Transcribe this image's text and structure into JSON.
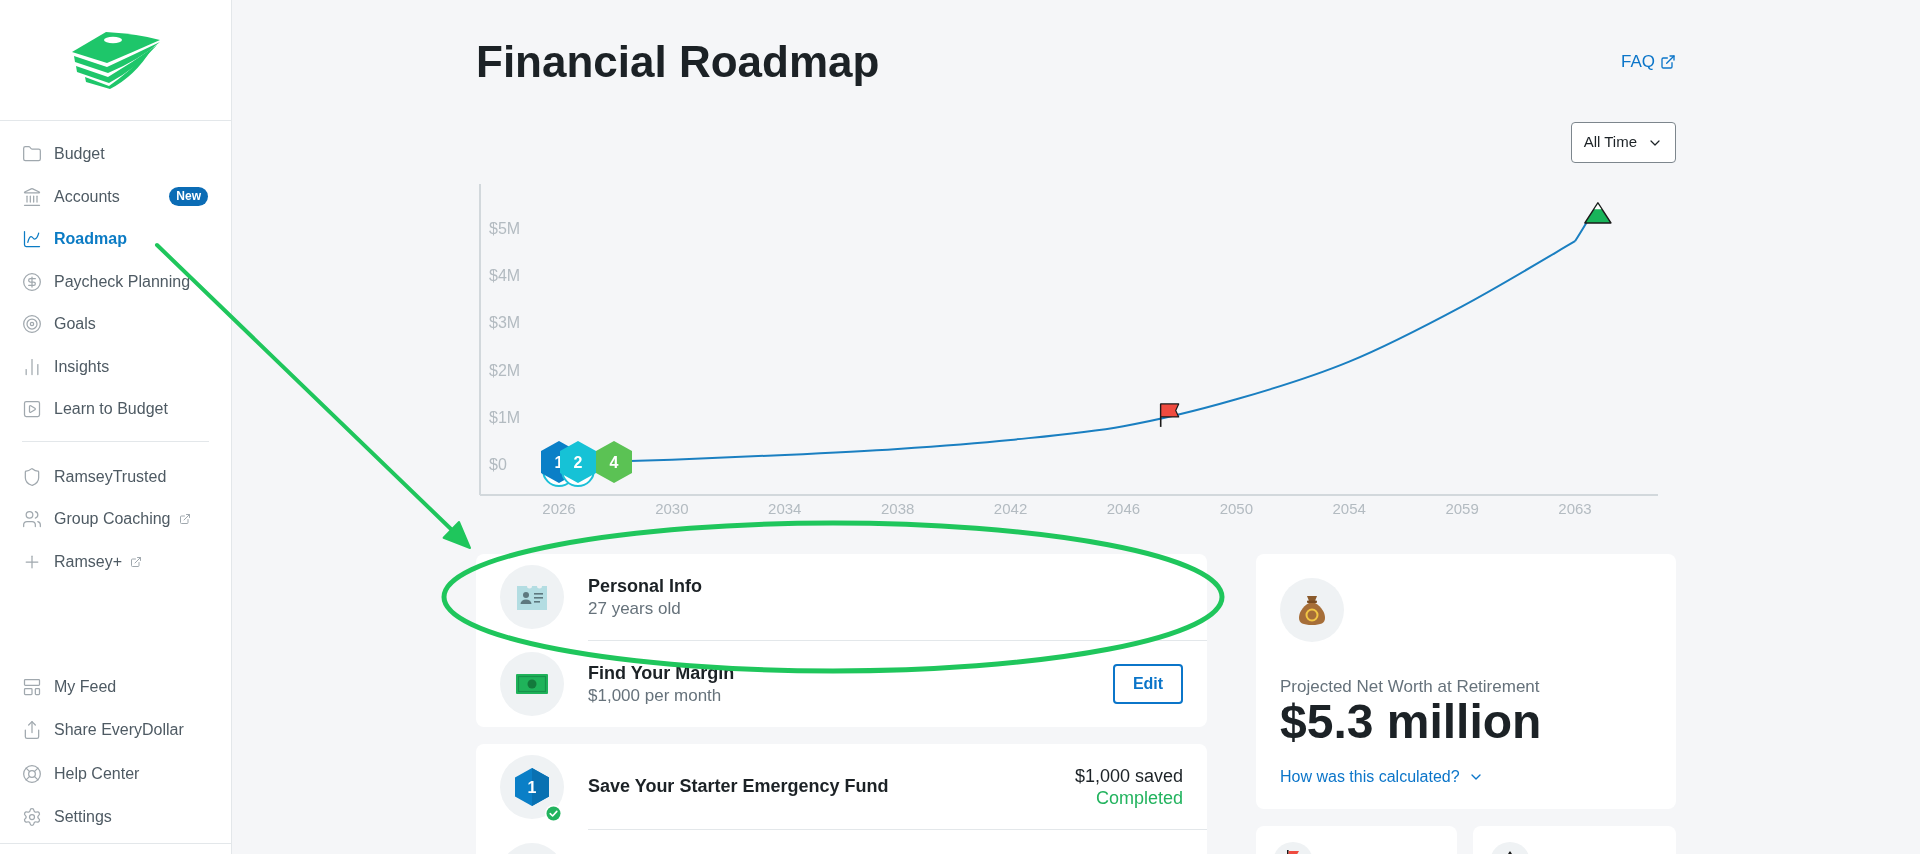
{
  "sidebar": {
    "sections": [
      {
        "items": [
          {
            "label": "Budget",
            "selected": false,
            "external": false
          },
          {
            "label": "Accounts",
            "selected": false,
            "external": false,
            "badge": "New"
          },
          {
            "label": "Roadmap",
            "selected": true,
            "external": false
          },
          {
            "label": "Paycheck Planning",
            "selected": false,
            "external": false
          },
          {
            "label": "Goals",
            "selected": false,
            "external": false
          },
          {
            "label": "Insights",
            "selected": false,
            "external": false
          },
          {
            "label": "Learn to Budget",
            "selected": false,
            "external": false
          }
        ]
      },
      {
        "items": [
          {
            "label": "RamseyTrusted",
            "selected": false,
            "external": false
          },
          {
            "label": "Group Coaching",
            "selected": false,
            "external": true
          },
          {
            "label": "Ramsey+",
            "selected": false,
            "external": true
          }
        ]
      },
      {
        "items": [
          {
            "label": "My Feed",
            "selected": false,
            "external": false
          },
          {
            "label": "Share EveryDollar",
            "selected": false,
            "external": false
          },
          {
            "label": "Help Center",
            "selected": false,
            "external": false
          },
          {
            "label": "Settings",
            "selected": false,
            "external": false
          }
        ]
      }
    ]
  },
  "header": {
    "title": "Financial Roadmap",
    "faq_link": "FAQ"
  },
  "roadmap_chart": {
    "range_select": {
      "value": "All Time"
    },
    "chart_data": {
      "type": "line",
      "categories": [
        "2026",
        "2030",
        "2034",
        "2038",
        "2042",
        "2046",
        "2050",
        "2054",
        "2059",
        "2063"
      ],
      "series": [
        {
          "color": "#1a7fc1",
          "values": [
            0.02,
            0.09,
            0.19,
            0.32,
            0.51,
            0.8,
            1.37,
            2.17,
            3.34,
            4.72
          ]
        }
      ],
      "ylim": [
        -0.657,
        5.932
      ],
      "yticks": [
        {
          "value": 0,
          "label": "$0"
        },
        {
          "value": 1,
          "label": "$1M"
        },
        {
          "value": 2,
          "label": "$2M"
        },
        {
          "value": 3,
          "label": "$3M"
        },
        {
          "value": 4,
          "label": "$4M"
        },
        {
          "value": 5,
          "label": "$5M"
        }
      ]
    },
    "markers": [
      {
        "kind": "step",
        "label": "1",
        "color": "#0a7fc7",
        "ring": true
      },
      {
        "kind": "step",
        "label": "2",
        "color": "#16c2d6",
        "ring": true
      },
      {
        "kind": "step",
        "label": "4",
        "color": "#5bc254",
        "ring": false
      },
      {
        "kind": "flag"
      },
      {
        "kind": "peak"
      }
    ]
  },
  "setup_card": {
    "rows": [
      {
        "title": "Personal Info",
        "subtitle": "27 years old"
      },
      {
        "title": "Find Your Margin",
        "subtitle": "$1,000 per month",
        "action": "Edit"
      }
    ]
  },
  "steps_card": {
    "steps": [
      {
        "badge": "1",
        "title": "Save Your Starter Emergency Fund",
        "amount": "$1,000 saved",
        "status": "Completed",
        "completed": true
      }
    ]
  },
  "net_worth_card": {
    "label": "Projected Net Worth at Retirement",
    "value": "$5.3 million",
    "link": "How was this calculated?"
  }
}
